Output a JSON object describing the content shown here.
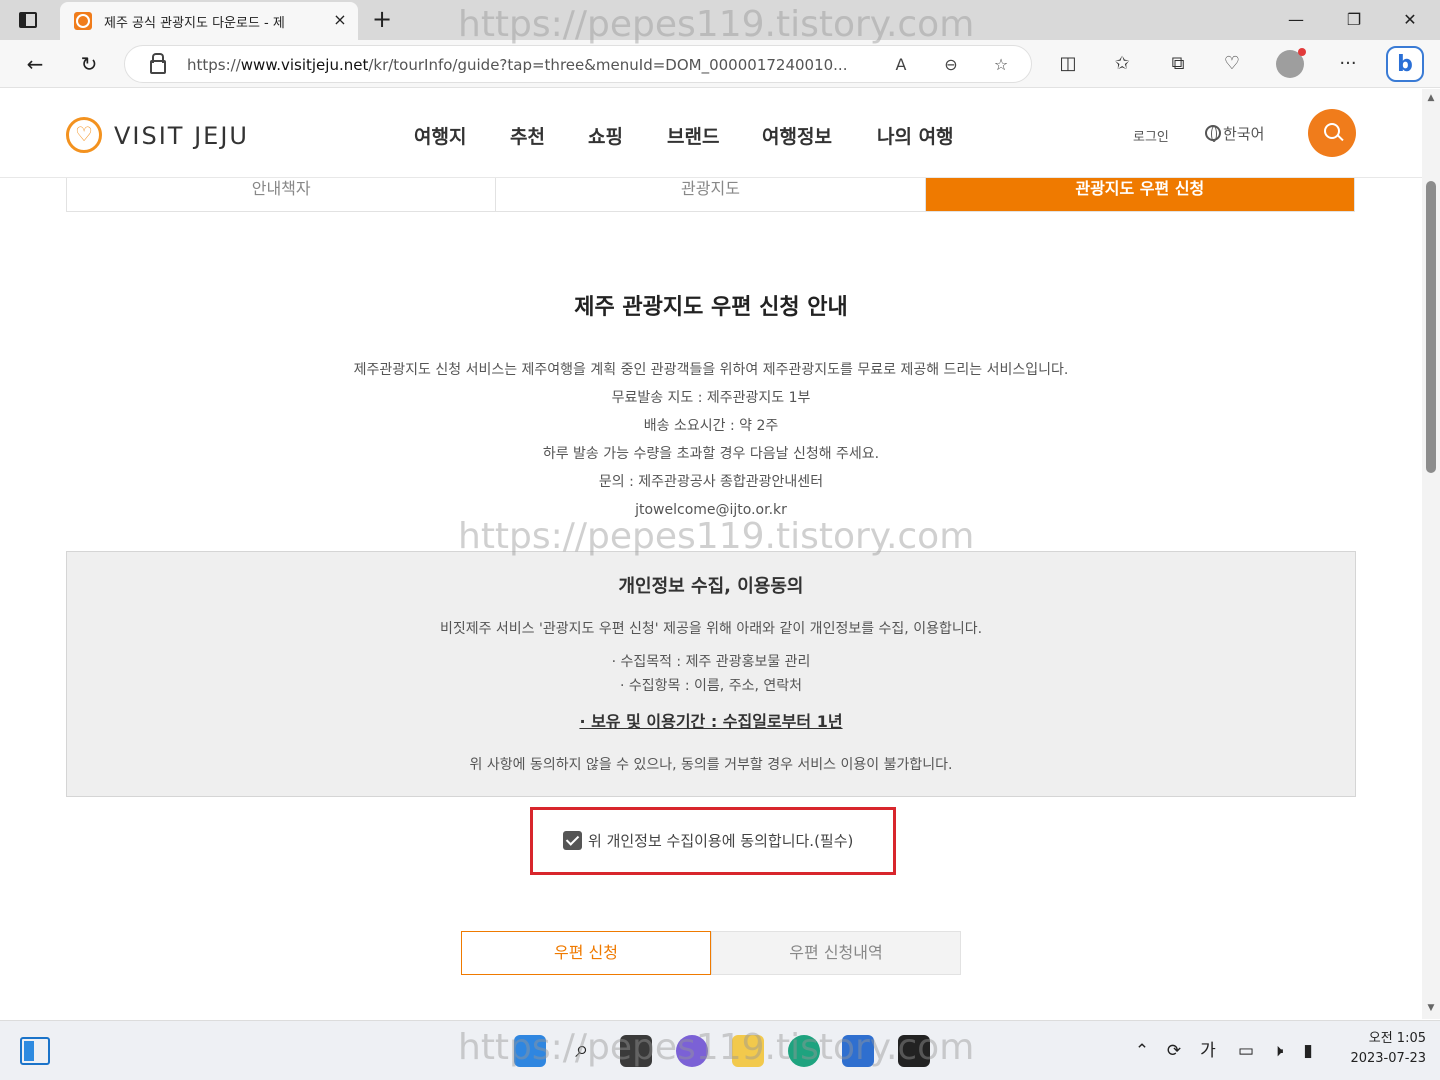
{
  "browser": {
    "tab_title": "제주 공식 관광지도 다운로드 - 제",
    "url_prefix": "https://",
    "url_host": "www.visitjeju.net",
    "url_path": "/kr/tourInfo/guide?tap=three&menuId=DOM_0000017240010...",
    "read_aloud_icon": "A",
    "close_tab_icon": "×",
    "new_tab_icon": "+"
  },
  "site": {
    "logo_text": "VISIT JEJU",
    "nav": [
      "여행지",
      "추천",
      "쇼핑",
      "브랜드",
      "여행정보",
      "나의 여행"
    ],
    "login": "로그인",
    "language": "한국어"
  },
  "subtabs": [
    "안내책자",
    "관광지도",
    "관광지도 우편 신청"
  ],
  "content": {
    "title": "제주 관광지도 우편 신청 안내",
    "info": [
      "제주관광지도 신청 서비스는 제주여행을 계획 중인 관광객들을 위하여 제주관광지도를 무료로 제공해 드리는 서비스입니다.",
      "무료발송 지도 : 제주관광지도 1부",
      "배송 소요시간 : 약 2주",
      "하루 발송 가능 수량을 초과할 경우 다음날 신청해 주세요.",
      "문의 : 제주관광공사 종합관광안내센터",
      "jtowelcome@ijto.or.kr"
    ]
  },
  "consent": {
    "title": "개인정보 수집, 이용동의",
    "desc": "비짓제주 서비스 '관광지도 우편 신청' 제공을 위해 아래와 같이 개인정보를 수집, 이용합니다.",
    "items": [
      "· 수집목적 : 제주 관광홍보물 관리",
      "· 수집항목 : 이름, 주소, 연락처"
    ],
    "period": "· 보유 및 이용기간 : 수집일로부터 1년",
    "note": "위 사항에 동의하지 않을 수 있으나, 동의를 거부할 경우 서비스 이용이 불가합니다.",
    "agree_label": "위 개인정보 수집이용에 동의합니다.(필수)",
    "agree_checked": true
  },
  "buttons": {
    "apply": "우편 신청",
    "history": "우편 신청내역"
  },
  "watermark": "https://pepes119.tistory.com",
  "taskbar": {
    "ime": "가",
    "time": "오전 1:05",
    "date": "2023-07-23"
  },
  "colors": {
    "accent": "#ef7a00",
    "highlight": "#d8262c"
  }
}
